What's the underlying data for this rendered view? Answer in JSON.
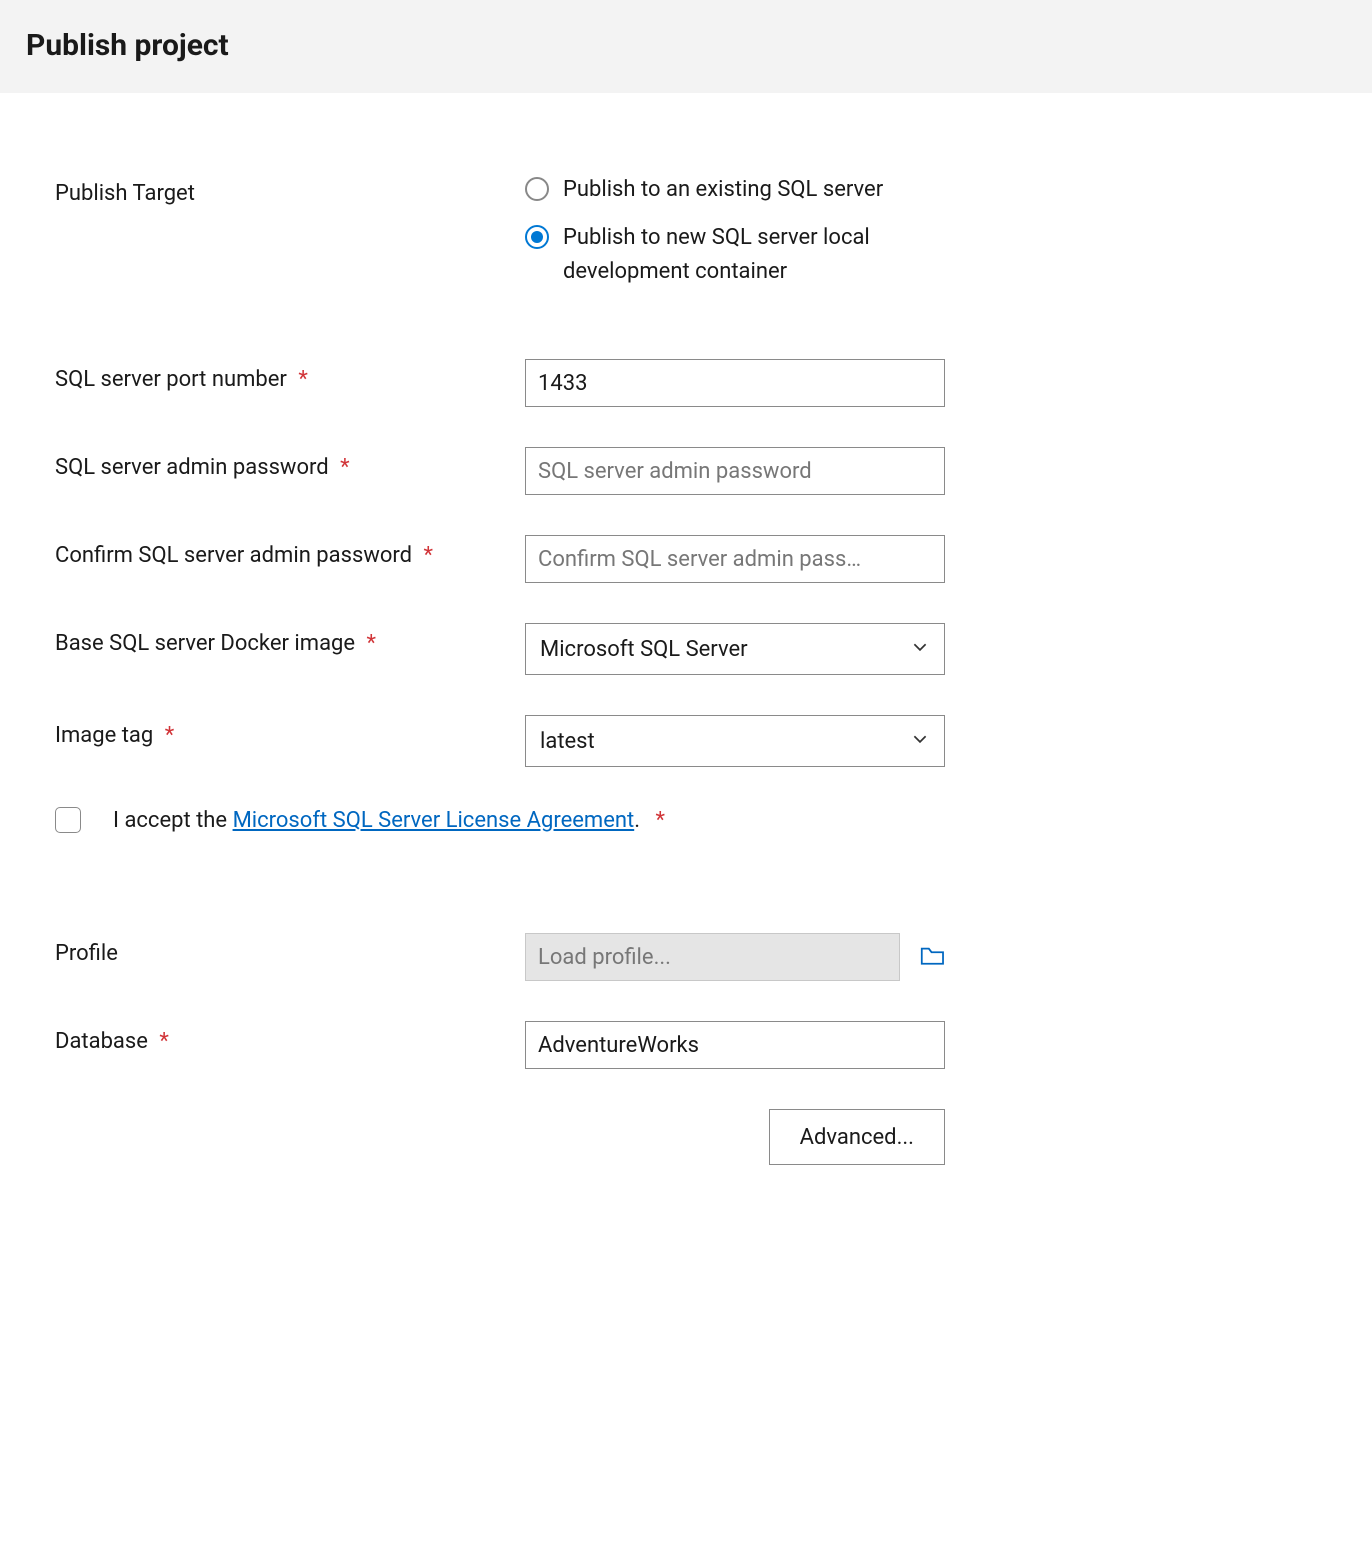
{
  "header": {
    "title": "Publish project"
  },
  "fields": {
    "publishTarget": {
      "label": "Publish Target",
      "options": {
        "existing": "Publish to an existing SQL server",
        "newContainer": "Publish to new SQL server local development container"
      },
      "selected": "newContainer"
    },
    "port": {
      "label": "SQL server port number",
      "value": "1433"
    },
    "adminPassword": {
      "label": "SQL server admin password",
      "placeholder": "SQL server admin password",
      "value": ""
    },
    "confirmPassword": {
      "label": "Confirm SQL server admin password",
      "placeholder": "Confirm SQL server admin pass…",
      "value": ""
    },
    "dockerImage": {
      "label": "Base SQL server Docker image",
      "value": "Microsoft SQL Server"
    },
    "imageTag": {
      "label": "Image tag",
      "value": "latest"
    },
    "license": {
      "prefix": "I accept the ",
      "linkText": "Microsoft SQL Server License Agreement",
      "suffix": "."
    },
    "profile": {
      "label": "Profile",
      "placeholder": "Load profile..."
    },
    "database": {
      "label": "Database",
      "value": "AdventureWorks"
    }
  },
  "buttons": {
    "advanced": "Advanced..."
  },
  "requiredMark": "*"
}
